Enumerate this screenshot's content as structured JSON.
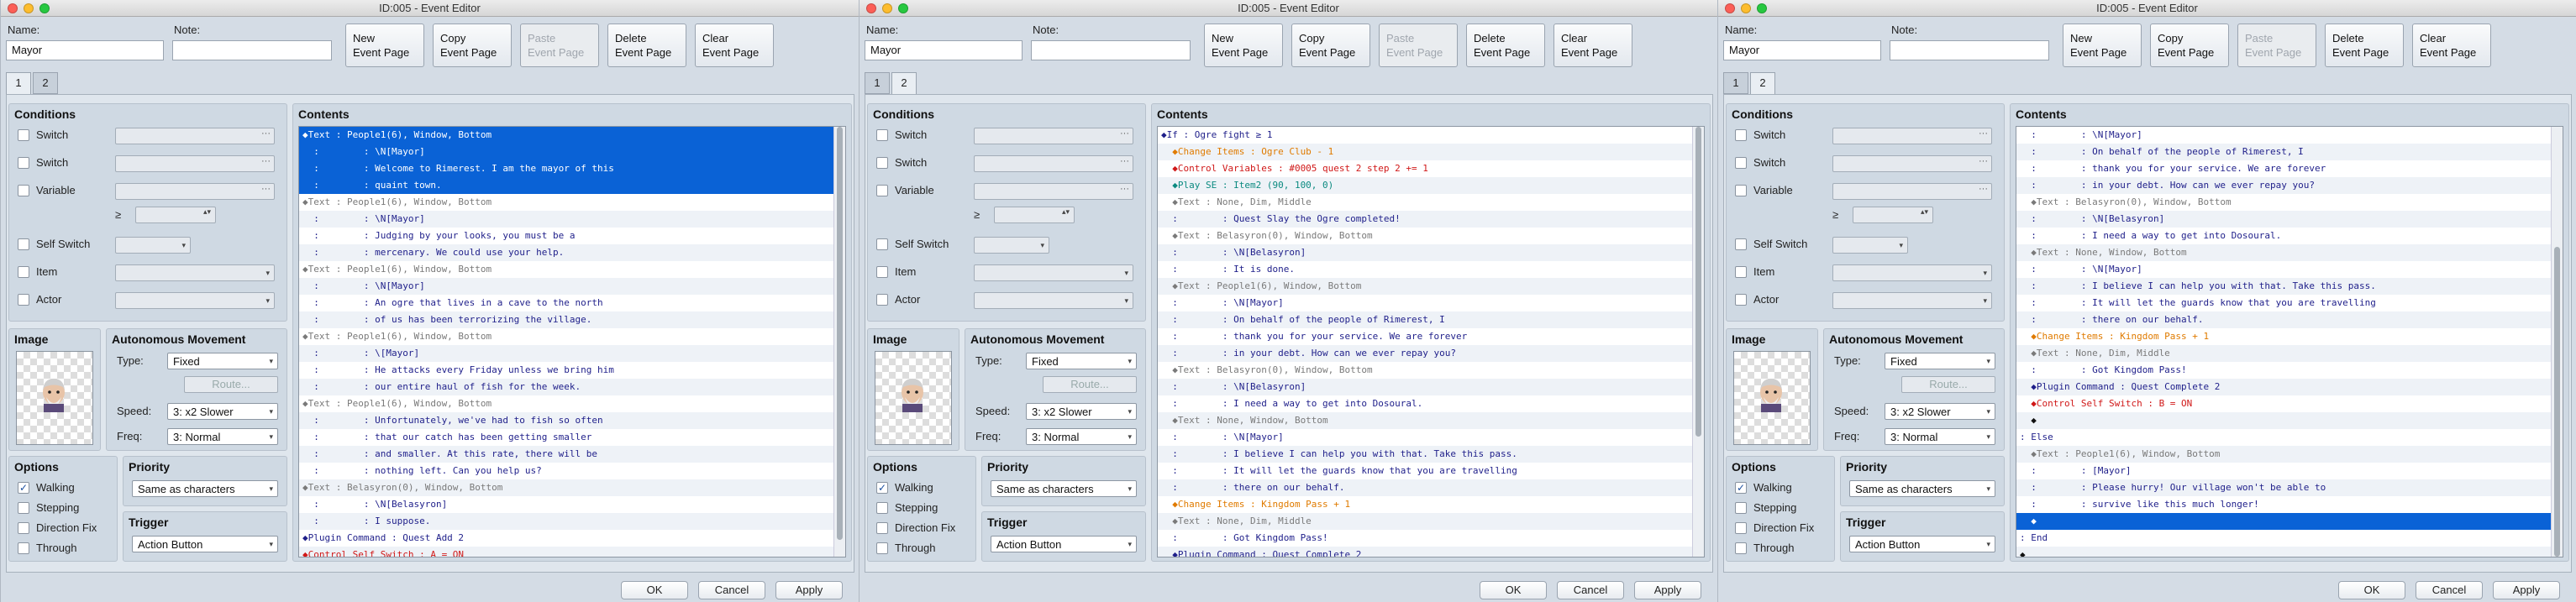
{
  "windows": [
    {
      "title": "ID:005 - Event Editor",
      "name_label": "Name:",
      "name_value": "Mayor",
      "note_label": "Note:",
      "note_value": "",
      "toolbar": [
        {
          "label": "New\nEvent Page",
          "enabled": true
        },
        {
          "label": "Copy\nEvent Page",
          "enabled": true
        },
        {
          "label": "Paste\nEvent Page",
          "enabled": false
        },
        {
          "label": "Delete\nEvent Page",
          "enabled": true
        },
        {
          "label": "Clear\nEvent Page",
          "enabled": true
        }
      ],
      "tabs": [
        "1",
        "2"
      ],
      "active_tab": 0,
      "conditions": {
        "header": "Conditions",
        "switch1": "Switch",
        "switch2": "Switch",
        "variable": "Variable",
        "ge": "≥",
        "self_switch": "Self Switch",
        "item": "Item",
        "actor": "Actor"
      },
      "image_header": "Image",
      "auto": {
        "header": "Autonomous Movement",
        "type_label": "Type:",
        "type_value": "Fixed",
        "route": "Route...",
        "speed_label": "Speed:",
        "speed_value": "3: x2 Slower",
        "freq_label": "Freq:",
        "freq_value": "3: Normal"
      },
      "options": {
        "header": "Options",
        "items": [
          {
            "label": "Walking",
            "checked": true
          },
          {
            "label": "Stepping",
            "checked": false
          },
          {
            "label": "Direction Fix",
            "checked": false
          },
          {
            "label": "Through",
            "checked": false
          }
        ]
      },
      "priority": {
        "header": "Priority",
        "value": "Same as characters"
      },
      "trigger": {
        "header": "Trigger",
        "value": "Action Button"
      },
      "contents_header": "Contents",
      "rows": [
        {
          "t": "◆Text : People1(6), Window, Bottom",
          "c": "navy",
          "sel": true
        },
        {
          "t": "  :        : \\N[Mayor]",
          "c": "navy",
          "sel": true
        },
        {
          "t": "  :        : Welcome to Rimerest. I am the mayor of this",
          "c": "navy",
          "sel": true
        },
        {
          "t": "  :        : quaint town.",
          "c": "navy",
          "sel": true
        },
        {
          "t": "◆Text : People1(6), Window, Bottom",
          "c": "gray"
        },
        {
          "t": "  :        : \\N[Mayor]",
          "c": "navy"
        },
        {
          "t": "  :        : Judging by your looks, you must be a",
          "c": "navy"
        },
        {
          "t": "  :        : mercenary. We could use your help.",
          "c": "navy"
        },
        {
          "t": "◆Text : People1(6), Window, Bottom",
          "c": "gray"
        },
        {
          "t": "  :        : \\N[Mayor]",
          "c": "navy"
        },
        {
          "t": "  :        : An ogre that lives in a cave to the north",
          "c": "navy"
        },
        {
          "t": "  :        : of us has been terrorizing the village.",
          "c": "navy"
        },
        {
          "t": "◆Text : People1(6), Window, Bottom",
          "c": "gray"
        },
        {
          "t": "  :        : \\[Mayor]",
          "c": "navy"
        },
        {
          "t": "  :        : He attacks every Friday unless we bring him",
          "c": "navy"
        },
        {
          "t": "  :        : our entire haul of fish for the week.",
          "c": "navy"
        },
        {
          "t": "◆Text : People1(6), Window, Bottom",
          "c": "gray"
        },
        {
          "t": "  :        : Unfortunately, we've had to fish so often",
          "c": "navy"
        },
        {
          "t": "  :        : that our catch has been getting smaller",
          "c": "navy"
        },
        {
          "t": "  :        : and smaller. At this rate, there will be",
          "c": "navy"
        },
        {
          "t": "  :        : nothing left. Can you help us?",
          "c": "navy"
        },
        {
          "t": "◆Text : Belasyron(0), Window, Bottom",
          "c": "gray"
        },
        {
          "t": "  :        : \\N[Belasyron]",
          "c": "navy"
        },
        {
          "t": "  :        : I suppose.",
          "c": "navy"
        },
        {
          "t": "◆Plugin Command : Quest Add 2",
          "c": "navy"
        },
        {
          "t": "◆Control Self Switch : A = ON",
          "c": "red"
        }
      ],
      "thumb_top": 0.0,
      "thumb_h": 0.96,
      "ok": "OK",
      "cancel": "Cancel",
      "apply": "Apply"
    },
    {
      "title": "ID:005 - Event Editor",
      "name_label": "Name:",
      "name_value": "Mayor",
      "note_label": "Note:",
      "note_value": "",
      "toolbar": [
        {
          "label": "New\nEvent Page",
          "enabled": true
        },
        {
          "label": "Copy\nEvent Page",
          "enabled": true
        },
        {
          "label": "Paste\nEvent Page",
          "enabled": false
        },
        {
          "label": "Delete\nEvent Page",
          "enabled": true
        },
        {
          "label": "Clear\nEvent Page",
          "enabled": true
        }
      ],
      "tabs": [
        "1",
        "2"
      ],
      "active_tab": 1,
      "conditions": {
        "header": "Conditions",
        "switch1": "Switch",
        "switch2": "Switch",
        "variable": "Variable",
        "ge": "≥",
        "self_switch": "Self Switch",
        "item": "Item",
        "actor": "Actor"
      },
      "image_header": "Image",
      "auto": {
        "header": "Autonomous Movement",
        "type_label": "Type:",
        "type_value": "Fixed",
        "route": "Route...",
        "speed_label": "Speed:",
        "speed_value": "3: x2 Slower",
        "freq_label": "Freq:",
        "freq_value": "3: Normal"
      },
      "options": {
        "header": "Options",
        "items": [
          {
            "label": "Walking",
            "checked": true
          },
          {
            "label": "Stepping",
            "checked": false
          },
          {
            "label": "Direction Fix",
            "checked": false
          },
          {
            "label": "Through",
            "checked": false
          }
        ]
      },
      "priority": {
        "header": "Priority",
        "value": "Same as characters"
      },
      "trigger": {
        "header": "Trigger",
        "value": "Action Button"
      },
      "contents_header": "Contents",
      "rows": [
        {
          "t": "◆If : Ogre fight ≥ 1",
          "c": "navy"
        },
        {
          "t": "  ◆Change Items : Ogre Club - 1",
          "c": "orange"
        },
        {
          "t": "  ◆Control Variables : #0005 quest 2 step 2 += 1",
          "c": "red"
        },
        {
          "t": "  ◆Play SE : Item2 (90, 100, 0)",
          "c": "teal"
        },
        {
          "t": "  ◆Text : None, Dim, Middle",
          "c": "gray"
        },
        {
          "t": "  :        : Quest Slay the Ogre completed!",
          "c": "navy"
        },
        {
          "t": "  ◆Text : Belasyron(0), Window, Bottom",
          "c": "gray"
        },
        {
          "t": "  :        : \\N[Belasyron]",
          "c": "navy"
        },
        {
          "t": "  :        : It is done.",
          "c": "navy"
        },
        {
          "t": "  ◆Text : People1(6), Window, Bottom",
          "c": "gray"
        },
        {
          "t": "  :        : \\N[Mayor]",
          "c": "navy"
        },
        {
          "t": "  :        : On behalf of the people of Rimerest, I",
          "c": "navy"
        },
        {
          "t": "  :        : thank you for your service. We are forever",
          "c": "navy"
        },
        {
          "t": "  :        : in your debt. How can we ever repay you?",
          "c": "navy"
        },
        {
          "t": "  ◆Text : Belasyron(0), Window, Bottom",
          "c": "gray"
        },
        {
          "t": "  :        : \\N[Belasyron]",
          "c": "navy"
        },
        {
          "t": "  :        : I need a way to get into Dosoural.",
          "c": "navy"
        },
        {
          "t": "  ◆Text : None, Window, Bottom",
          "c": "gray"
        },
        {
          "t": "  :        : \\N[Mayor]",
          "c": "navy"
        },
        {
          "t": "  :        : I believe I can help you with that. Take this pass.",
          "c": "navy"
        },
        {
          "t": "  :        : It will let the guards know that you are travelling",
          "c": "navy"
        },
        {
          "t": "  :        : there on our behalf.",
          "c": "navy"
        },
        {
          "t": "  ◆Change Items : Kingdom Pass + 1",
          "c": "orange"
        },
        {
          "t": "  ◆Text : None, Dim, Middle",
          "c": "gray"
        },
        {
          "t": "  :        : Got Kingdom Pass!",
          "c": "navy"
        },
        {
          "t": "  ◆Plugin Command : Quest Complete 2",
          "c": "navy"
        }
      ],
      "thumb_top": 0.0,
      "thumb_h": 0.72,
      "ok": "OK",
      "cancel": "Cancel",
      "apply": "Apply"
    },
    {
      "title": "ID:005 - Event Editor",
      "name_label": "Name:",
      "name_value": "Mayor",
      "note_label": "Note:",
      "note_value": "",
      "toolbar": [
        {
          "label": "New\nEvent Page",
          "enabled": true
        },
        {
          "label": "Copy\nEvent Page",
          "enabled": true
        },
        {
          "label": "Paste\nEvent Page",
          "enabled": false
        },
        {
          "label": "Delete\nEvent Page",
          "enabled": true
        },
        {
          "label": "Clear\nEvent Page",
          "enabled": true
        }
      ],
      "tabs": [
        "1",
        "2"
      ],
      "active_tab": 1,
      "conditions": {
        "header": "Conditions",
        "switch1": "Switch",
        "switch2": "Switch",
        "variable": "Variable",
        "ge": "≥",
        "self_switch": "Self Switch",
        "item": "Item",
        "actor": "Actor"
      },
      "image_header": "Image",
      "auto": {
        "header": "Autonomous Movement",
        "type_label": "Type:",
        "type_value": "Fixed",
        "route": "Route...",
        "speed_label": "Speed:",
        "speed_value": "3: x2 Slower",
        "freq_label": "Freq:",
        "freq_value": "3: Normal"
      },
      "options": {
        "header": "Options",
        "items": [
          {
            "label": "Walking",
            "checked": true
          },
          {
            "label": "Stepping",
            "checked": false
          },
          {
            "label": "Direction Fix",
            "checked": false
          },
          {
            "label": "Through",
            "checked": false
          }
        ]
      },
      "priority": {
        "header": "Priority",
        "value": "Same as characters"
      },
      "trigger": {
        "header": "Trigger",
        "value": "Action Button"
      },
      "contents_header": "Contents",
      "rows": [
        {
          "t": "  :        : \\N[Mayor]",
          "c": "navy"
        },
        {
          "t": "  :        : On behalf of the people of Rimerest, I",
          "c": "navy"
        },
        {
          "t": "  :        : thank you for your service. We are forever",
          "c": "navy"
        },
        {
          "t": "  :        : in your debt. How can we ever repay you?",
          "c": "navy"
        },
        {
          "t": "  ◆Text : Belasyron(0), Window, Bottom",
          "c": "gray"
        },
        {
          "t": "  :        : \\N[Belasyron]",
          "c": "navy"
        },
        {
          "t": "  :        : I need a way to get into Dosoural.",
          "c": "navy"
        },
        {
          "t": "  ◆Text : None, Window, Bottom",
          "c": "gray"
        },
        {
          "t": "  :        : \\N[Mayor]",
          "c": "navy"
        },
        {
          "t": "  :        : I believe I can help you with that. Take this pass.",
          "c": "navy"
        },
        {
          "t": "  :        : It will let the guards know that you are travelling",
          "c": "navy"
        },
        {
          "t": "  :        : there on our behalf.",
          "c": "navy"
        },
        {
          "t": "  ◆Change Items : Kingdom Pass + 1",
          "c": "orange"
        },
        {
          "t": "  ◆Text : None, Dim, Middle",
          "c": "gray"
        },
        {
          "t": "  :        : Got Kingdom Pass!",
          "c": "navy"
        },
        {
          "t": "  ◆Plugin Command : Quest Complete 2",
          "c": "navy"
        },
        {
          "t": "  ◆Control Self Switch : B = ON",
          "c": "red"
        },
        {
          "t": "  ◆",
          "c": "black"
        },
        {
          "t": ": Else",
          "c": "navy"
        },
        {
          "t": "  ◆Text : People1(6), Window, Bottom",
          "c": "gray"
        },
        {
          "t": "  :        : [Mayor]",
          "c": "navy"
        },
        {
          "t": "  :        : Please hurry! Our village won't be able to",
          "c": "navy"
        },
        {
          "t": "  :        : survive like this much longer!",
          "c": "navy"
        },
        {
          "t": "  ◆",
          "c": "black",
          "sel": true
        },
        {
          "t": ": End",
          "c": "navy"
        },
        {
          "t": "◆",
          "c": "black"
        }
      ],
      "thumb_top": 0.28,
      "thumb_h": 0.72,
      "ok": "OK",
      "cancel": "Cancel",
      "apply": "Apply"
    }
  ]
}
